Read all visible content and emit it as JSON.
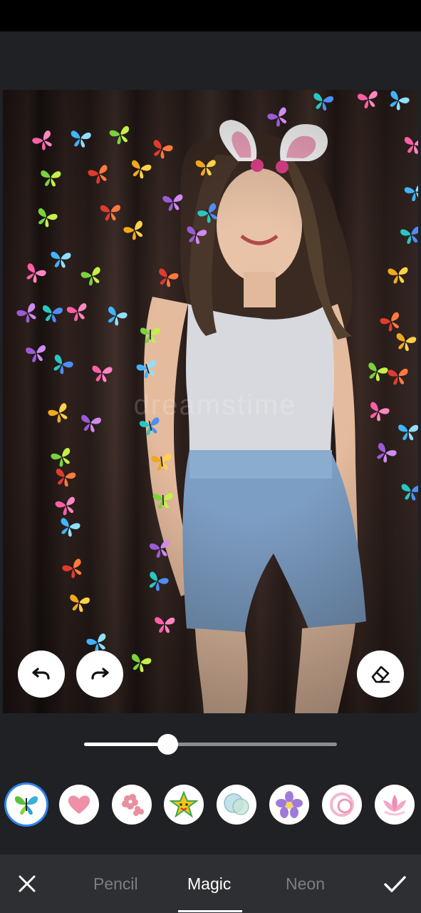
{
  "watermark": "dreamstime",
  "toolbar": {
    "undo_icon": "undo-icon",
    "redo_icon": "redo-icon",
    "eraser_icon": "eraser-icon"
  },
  "slider": {
    "value": 0.33
  },
  "brushes": [
    {
      "name": "butterfly",
      "selected": true
    },
    {
      "name": "heart",
      "selected": false
    },
    {
      "name": "sakura",
      "selected": false
    },
    {
      "name": "star",
      "selected": false
    },
    {
      "name": "bubble",
      "selected": false
    },
    {
      "name": "flower",
      "selected": false
    },
    {
      "name": "ring",
      "selected": false
    },
    {
      "name": "lotus",
      "selected": false
    }
  ],
  "tabs": {
    "pencil": "Pencil",
    "magic": "Magic",
    "neon": "Neon"
  },
  "actions": {
    "cancel_icon": "close-icon",
    "apply_icon": "check-icon"
  },
  "colors": {
    "accent": "#2f86f0",
    "background": "#1f2125",
    "bottom_bar": "#2d2f33"
  }
}
